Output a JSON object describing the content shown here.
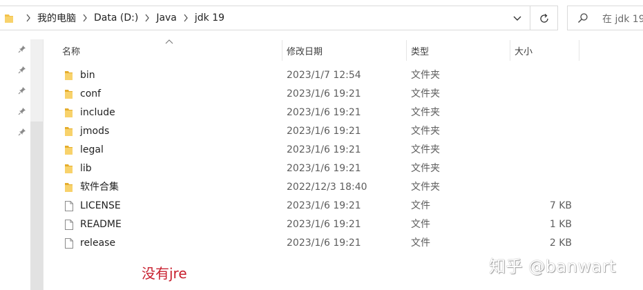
{
  "address_bar": {
    "breadcrumbs": [
      "我的电脑",
      "Data (D:)",
      "Java",
      "jdk 19"
    ]
  },
  "search": {
    "placeholder": "在 jdk 19"
  },
  "columns": {
    "name": "名称",
    "modified": "修改日期",
    "type": "类型",
    "size": "大小"
  },
  "files": [
    {
      "name": "bin",
      "modified": "2023/1/7 12:54",
      "type": "文件夹",
      "size": "",
      "icon": "folder-icon"
    },
    {
      "name": "conf",
      "modified": "2023/1/6 19:21",
      "type": "文件夹",
      "size": "",
      "icon": "folder-icon"
    },
    {
      "name": "include",
      "modified": "2023/1/6 19:21",
      "type": "文件夹",
      "size": "",
      "icon": "folder-icon"
    },
    {
      "name": "jmods",
      "modified": "2023/1/6 19:21",
      "type": "文件夹",
      "size": "",
      "icon": "folder-icon"
    },
    {
      "name": "legal",
      "modified": "2023/1/6 19:21",
      "type": "文件夹",
      "size": "",
      "icon": "folder-icon"
    },
    {
      "name": "lib",
      "modified": "2023/1/6 19:21",
      "type": "文件夹",
      "size": "",
      "icon": "folder-icon"
    },
    {
      "name": "软件合集",
      "modified": "2022/12/3 18:40",
      "type": "文件夹",
      "size": "",
      "icon": "folder-icon"
    },
    {
      "name": "LICENSE",
      "modified": "2023/1/6 19:21",
      "type": "文件",
      "size": "7 KB",
      "icon": "file-icon"
    },
    {
      "name": "README",
      "modified": "2023/1/6 19:21",
      "type": "文件",
      "size": "1 KB",
      "icon": "file-icon"
    },
    {
      "name": "release",
      "modified": "2023/1/6 19:21",
      "type": "文件",
      "size": "2 KB",
      "icon": "file-icon"
    }
  ],
  "annotation": "没有jre",
  "watermark": "知乎 @banwart",
  "colors": {
    "folder": "#f3c24b",
    "annotation": "#c8202f"
  }
}
